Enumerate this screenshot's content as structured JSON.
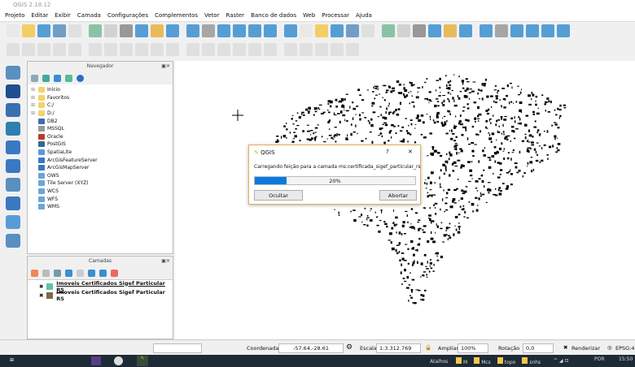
{
  "window": {
    "title": "QGIS 2.18.12"
  },
  "menu": [
    "Projeto",
    "Editar",
    "Exibir",
    "Camada",
    "Configurações",
    "Complementos",
    "Vetor",
    "Raster",
    "Banco de dados",
    "Web",
    "Processar",
    "Ajuda"
  ],
  "navigator": {
    "title": "Navegador",
    "items": [
      {
        "label": "Início",
        "icon": "folder-icon",
        "color": "#f3d36b"
      },
      {
        "label": "Favoritos",
        "icon": "star-folder-icon",
        "color": "#f3d36b"
      },
      {
        "label": "C:/",
        "icon": "folder-icon",
        "color": "#f3d36b"
      },
      {
        "label": "D:/",
        "icon": "folder-icon",
        "color": "#f3d36b"
      },
      {
        "label": "DB2",
        "icon": "db2-icon",
        "color": "#3a6fb0"
      },
      {
        "label": "MSSQL",
        "icon": "mssql-icon",
        "color": "#999999"
      },
      {
        "label": "Oracle",
        "icon": "oracle-icon",
        "color": "#c0392b"
      },
      {
        "label": "PostGIS",
        "icon": "postgis-icon",
        "color": "#336791"
      },
      {
        "label": "SpatiaLite",
        "icon": "spatialite-icon",
        "color": "#5a9bd5"
      },
      {
        "label": "ArcGisFeatureServer",
        "icon": "arcgis-icon",
        "color": "#3a78c2"
      },
      {
        "label": "ArcGisMapServer",
        "icon": "arcgis-icon",
        "color": "#3a78c2"
      },
      {
        "label": "OWS",
        "icon": "ows-icon",
        "color": "#6aa6d8"
      },
      {
        "label": "Tile Server (XYZ)",
        "icon": "xyz-icon",
        "color": "#6aa6d8"
      },
      {
        "label": "WCS",
        "icon": "wcs-icon",
        "color": "#6aa6d8"
      },
      {
        "label": "WFS",
        "icon": "wfs-icon",
        "color": "#6aa6d8"
      },
      {
        "label": "WMS",
        "icon": "wms-icon",
        "color": "#6aa6d8"
      }
    ]
  },
  "layers": {
    "title": "Camadas",
    "items": [
      {
        "label": "Imoveis Certificados Sigef Particular RS",
        "color": "#5fc4a4",
        "checked": true
      },
      {
        "label": "Imoveis Certificados Sigef Particular RS",
        "color": "#7a6a4a",
        "checked": true
      }
    ]
  },
  "dialog": {
    "title": "QGIS",
    "help": "?",
    "close": "✕",
    "message": "Carregando feição para a camada ms:certificada_sigef_particular_rs",
    "progress_percent": 20,
    "progress_label": "20%",
    "hide_label": "Ocultar",
    "abort_label": "Abortar",
    "accent": "#0a7ae0"
  },
  "status": {
    "coord_label": "Coordenada",
    "coord_value": "-57.64,-28.61",
    "scale_label": "Escala",
    "scale_value": "1:3.312.769",
    "zoom_label": "Ampliar",
    "zoom_value": "100%",
    "rotation_label": "Rotação",
    "rotation_value": "0,0",
    "render_label": "Renderizar",
    "crs_label": "EPSG:4"
  },
  "taskbar": {
    "shortcuts": "Atalhos",
    "folders": [
      "M",
      "Mcs",
      "topo",
      "snhs"
    ],
    "lang": "POR",
    "time": "15:50"
  }
}
